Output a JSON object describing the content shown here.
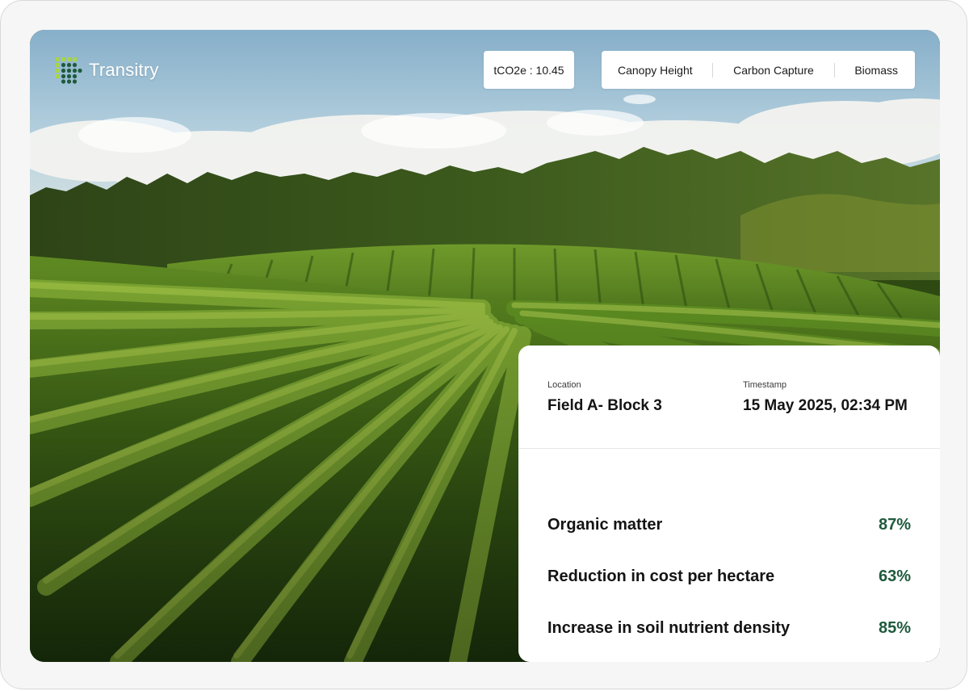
{
  "brand": {
    "name": "Transitry",
    "logo_icon": "dot-grid-logo-icon"
  },
  "carbon_chip": {
    "text": "tCO2e : 10.45"
  },
  "tabs": [
    {
      "label": "Canopy Height"
    },
    {
      "label": "Carbon Capture"
    },
    {
      "label": "Biomass"
    }
  ],
  "card": {
    "location_label": "Location",
    "location_value": "Field A- Block 3",
    "timestamp_label": "Timestamp",
    "timestamp_value": "15 May 2025, 02:34 PM",
    "metrics": [
      {
        "label": "Organic matter",
        "value": "87%"
      },
      {
        "label": "Reduction in cost per hectare",
        "value": "63%"
      },
      {
        "label": "Increase in soil nutrient density",
        "value": "85%"
      }
    ]
  },
  "colors": {
    "accent_green": "#1f5a3d",
    "logo_light": "#a8d44a",
    "logo_dark": "#1f5a3d",
    "sky": "#9cc3d8",
    "foliage": "#4b6e1c"
  }
}
